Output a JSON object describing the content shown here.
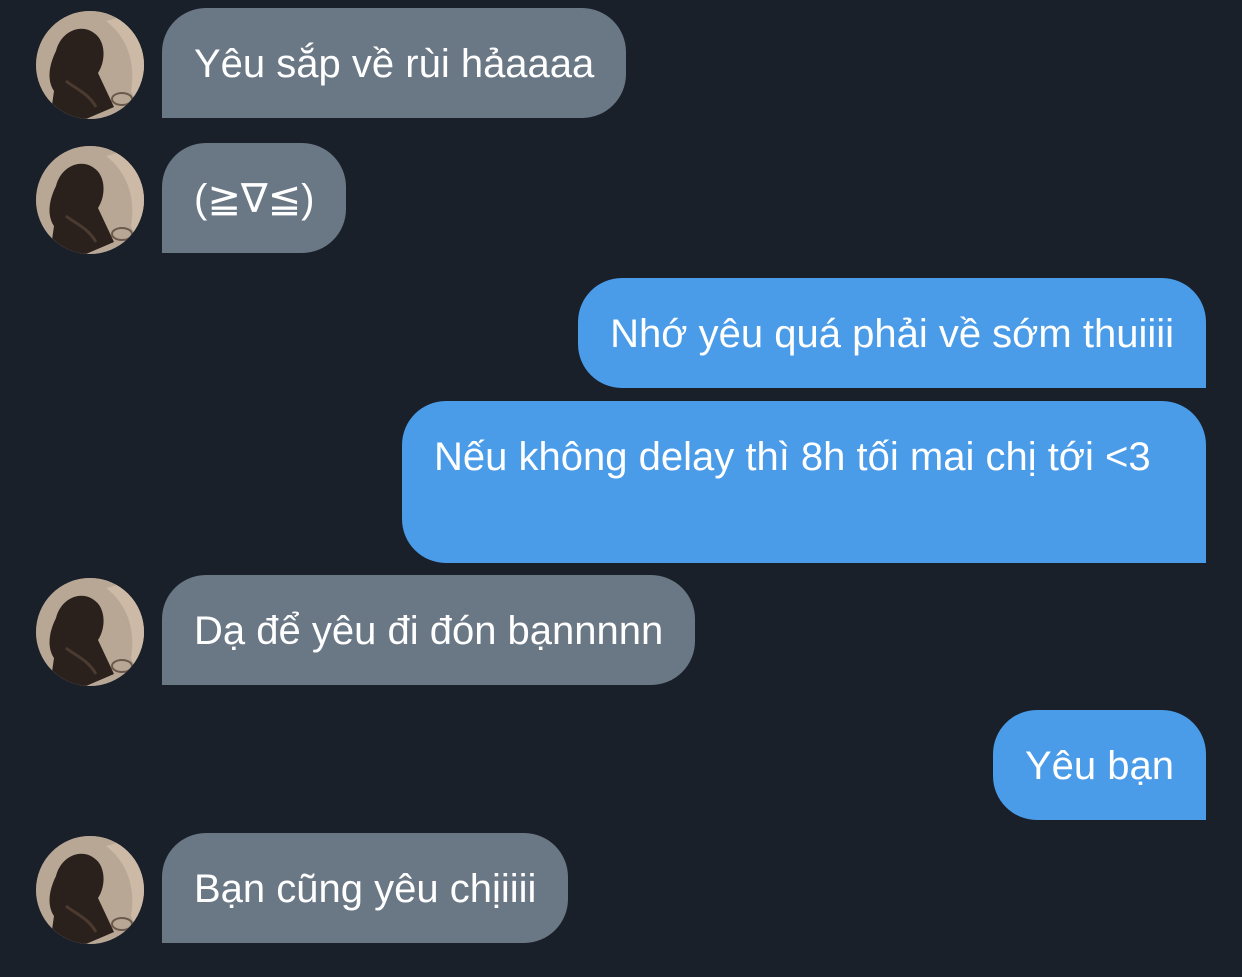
{
  "colors": {
    "background": "#19202a",
    "incoming_bubble": "#6a7785",
    "outgoing_bubble": "#4a9be8",
    "text": "#ffffff"
  },
  "contact": {
    "avatar_icon": "profile-photo-girl-long-dark-hair-on-sand"
  },
  "messages": [
    {
      "direction": "incoming",
      "text": "Yêu sắp về rùi hảaaaa"
    },
    {
      "direction": "incoming",
      "text": "(≧∇≦)"
    },
    {
      "direction": "outgoing",
      "text": "Nhớ yêu quá phải về sớm thuiiii"
    },
    {
      "direction": "outgoing",
      "text": "Nếu không delay thì 8h tối mai chị tới <3"
    },
    {
      "direction": "incoming",
      "text": "Dạ để yêu đi đón bạnnnnn"
    },
    {
      "direction": "outgoing",
      "text": "Yêu bạn"
    },
    {
      "direction": "incoming",
      "text": "Bạn cũng yêu chịiiii"
    }
  ]
}
